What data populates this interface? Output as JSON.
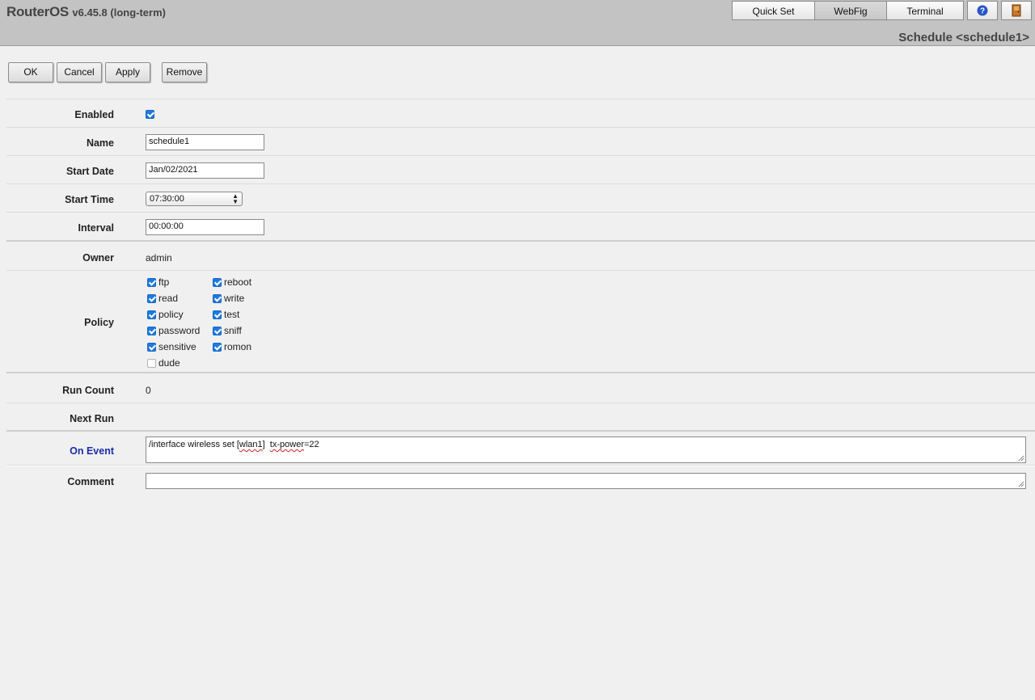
{
  "header": {
    "brand": "RouterOS",
    "version": "v6.45.8 (long-term)",
    "tabs": [
      {
        "label": "Quick Set",
        "active": false
      },
      {
        "label": "WebFig",
        "active": true
      },
      {
        "label": "Terminal",
        "active": false
      }
    ],
    "help_icon": "help-icon",
    "logout_icon": "logout-door-icon",
    "page_title": "Schedule <schedule1>"
  },
  "toolbar": {
    "ok_label": "OK",
    "cancel_label": "Cancel",
    "apply_label": "Apply",
    "remove_label": "Remove"
  },
  "form": {
    "enabled": {
      "label": "Enabled",
      "checked": true
    },
    "name": {
      "label": "Name",
      "value": "schedule1"
    },
    "start_date": {
      "label": "Start Date",
      "value": "Jan/02/2021"
    },
    "start_time": {
      "label": "Start Time",
      "value": "07:30:00"
    },
    "interval": {
      "label": "Interval",
      "value": "00:00:00"
    },
    "owner": {
      "label": "Owner",
      "value": "admin"
    },
    "policy": {
      "label": "Policy",
      "col1": [
        {
          "name": "ftp",
          "checked": true
        },
        {
          "name": "read",
          "checked": true
        },
        {
          "name": "policy",
          "checked": true
        },
        {
          "name": "password",
          "checked": true
        },
        {
          "name": "sensitive",
          "checked": true
        },
        {
          "name": "dude",
          "checked": false
        }
      ],
      "col2": [
        {
          "name": "reboot",
          "checked": true
        },
        {
          "name": "write",
          "checked": true
        },
        {
          "name": "test",
          "checked": true
        },
        {
          "name": "sniff",
          "checked": true
        },
        {
          "name": "romon",
          "checked": true
        }
      ]
    },
    "run_count": {
      "label": "Run Count",
      "value": "0"
    },
    "next_run": {
      "label": "Next Run",
      "value": ""
    },
    "on_event": {
      "label": "On Event",
      "value_prefix": "/interface wireless set [",
      "value_wlan": "wlan1",
      "value_mid": "]  ",
      "value_tx": "tx-power",
      "value_suffix": "=22"
    },
    "comment": {
      "label": "Comment",
      "value": ""
    }
  },
  "colors": {
    "header_bg": "#c3c3c3",
    "page_bg": "#f0f0f0",
    "checkbox_blue": "#1f7ae0",
    "on_event_label": "#1a2ea8"
  }
}
